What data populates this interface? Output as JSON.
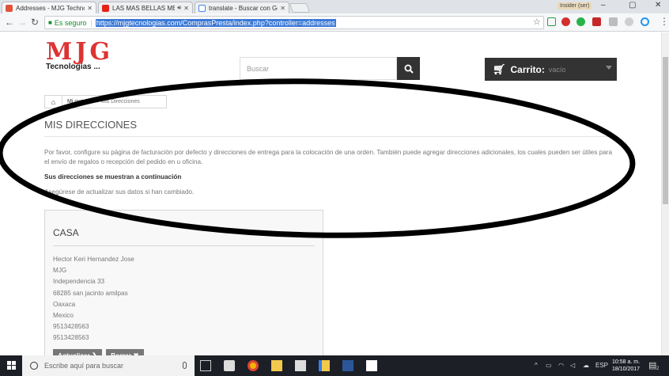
{
  "browser": {
    "tabs": [
      {
        "title": "Addresses - MJG Technolo",
        "active": true
      },
      {
        "title": "LAS MAS BELLAS MELO",
        "active": false
      },
      {
        "title": "translate - Buscar con Go",
        "active": false
      }
    ],
    "profile_name": "Insider (ser)",
    "window_controls": {
      "minimize": "–",
      "maximize": "▢",
      "close": "✕"
    },
    "secure_label": "Es seguro",
    "url": "https://mjgtecnologias.com/ComprasPresta/index.php?controller=addresses"
  },
  "header": {
    "logo_text": "MJG",
    "logo_sub": "Tecnologías ...",
    "search_placeholder": "Buscar",
    "cart_label": "Carrito:",
    "cart_status": "vacío"
  },
  "breadcrumb": {
    "items": [
      "Mi cuenta",
      "Mis Direcciones"
    ]
  },
  "main": {
    "title": "MIS DIRECCIONES",
    "intro": "Por favor, configure su página de facturación por defecto y direcciones de entrega para la colocación de una orden. También puede agregar direcciones adicionales, los cuales pueden ser útiles para el envío de regalos o recepción del pedido en u oficina.",
    "subhead": "Sus direcciones se muestran a continuación",
    "note": "Asegúrese de actualizar sus datos si han cambiado."
  },
  "address_card": {
    "title": "CASA",
    "lines": [
      "Hector Keri Hernandez Jose",
      "MJG",
      "Independencia 33",
      "68285 san jacinto amilpas",
      "Oaxaca",
      "Mexico",
      "9513428563",
      "9513428563"
    ],
    "update_label": "Actualizar ❯",
    "delete_label": "Borrar ✖"
  },
  "taskbar": {
    "search_placeholder": "Escribe aquí para buscar",
    "lang": "ESP",
    "time": "10:58 a. m.",
    "date": "18/10/2017",
    "notif_count": "2"
  },
  "colors": {
    "logo_red": "#dd3333",
    "dark": "#333333",
    "button_gray": "#777777",
    "url_highlight": "#3b79d6",
    "secure_green": "#168a2c"
  }
}
